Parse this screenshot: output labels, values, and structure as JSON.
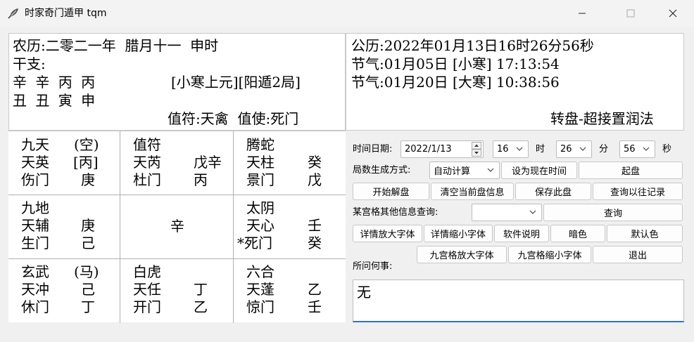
{
  "window": {
    "title": "时家奇门遁甲 tqm"
  },
  "info_left": {
    "lunar_line": "农历:二零二一年  腊月十一  申时",
    "ganzhi_label": "干支:",
    "gan_line": "辛 辛 丙 丙",
    "zhi_line": "丑 丑 寅 申",
    "ju_info": "[小寒上元][阳遁2局]",
    "zhifu_zhishi": "值符:天禽  值使:死门"
  },
  "info_right": {
    "gregorian": "公历:2022年01月13日16时26分56秒",
    "jieqi1": "节气:01月05日 [小寒] 17:13:54",
    "jieqi2": "节气:01月20日 [大寒] 10:38:56",
    "method": "转盘-超接置润法"
  },
  "grid": [
    {
      "god": "九天",
      "mark": "(空)",
      "star": "天英",
      "star_stem": "[丙]",
      "door": "伤门",
      "door_stem": "庚"
    },
    {
      "god": "值符",
      "mark": "",
      "star": "天芮",
      "star_stem": "戊辛",
      "door": "杜门",
      "door_stem": "丙"
    },
    {
      "god": "腾蛇",
      "mark": "",
      "star": "天柱",
      "star_stem": "癸",
      "door": "景门",
      "door_stem": "戊"
    },
    {
      "god": "九地",
      "mark": "",
      "star": "天辅",
      "star_stem": "庚",
      "door": "生门",
      "door_stem": "己"
    },
    {
      "center": "辛"
    },
    {
      "god": "太阴",
      "mark": "",
      "star": "天心",
      "star_stem": "壬",
      "door": "*死门",
      "door_stem": "癸"
    },
    {
      "god": "玄武",
      "mark": "(马)",
      "star": "天冲",
      "star_stem": "己",
      "door": "休门",
      "door_stem": "丁"
    },
    {
      "god": "白虎",
      "mark": "",
      "star": "天任",
      "star_stem": "丁",
      "door": "开门",
      "door_stem": "乙"
    },
    {
      "god": "六合",
      "mark": "",
      "star": "天蓬",
      "star_stem": "乙",
      "door": "惊门",
      "door_stem": "壬"
    }
  ],
  "controls": {
    "date_label": "时间日期:",
    "date_value": "2022/1/13",
    "hour_value": "16",
    "hour_unit": "时",
    "minute_value": "26",
    "minute_unit": "分",
    "second_value": "56",
    "second_unit": "秒",
    "mode_label": "局数生成方式:",
    "mode_value": "自动计算",
    "set_now": "设为现在时间",
    "start_pan": "起盘",
    "start_jiepan": "开始解盘",
    "clear_info": "清空当前盘信息",
    "save_pan": "保存此盘",
    "query_history": "查询以往记录",
    "other_info_label": "某宫格其他信息查询:",
    "other_info_value": "",
    "query": "查询",
    "detail_bigger": "详情放大字体",
    "detail_smaller": "详情缩小字体",
    "about": "软件说明",
    "dark": "暗色",
    "default_color": "默认色",
    "grid_bigger": "九宫格放大字体",
    "grid_smaller": "九宫格缩小字体",
    "exit": "退出",
    "question_label": "所问何事:",
    "question_value": "无"
  },
  "icons": {
    "app": "feather-icon",
    "minimize": "minimize-icon",
    "maximize": "maximize-icon",
    "close": "close-icon"
  }
}
